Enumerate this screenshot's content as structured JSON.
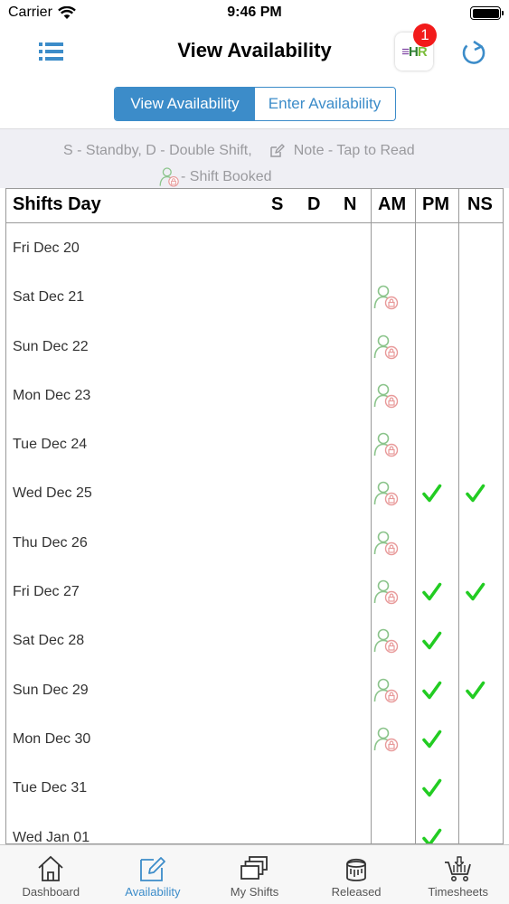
{
  "status_bar": {
    "carrier": "Carrier",
    "time": "9:46 PM"
  },
  "nav": {
    "title": "View Availability",
    "notification_count": "1",
    "logo_text": {
      "e": "≡",
      "h": "H",
      "r": "R"
    },
    "icons": {
      "menu": "list-icon",
      "refresh": "refresh-icon"
    }
  },
  "segments": {
    "view": "View Availability",
    "enter": "Enter Availability",
    "selected": "view"
  },
  "legend": {
    "line1": "S - Standby, D - Double Shift,",
    "note": "Note - Tap to Read",
    "booked": "- Shift Booked"
  },
  "table": {
    "headers": {
      "day": "Shifts Day",
      "s": "S",
      "d": "D",
      "n": "N",
      "am": "AM",
      "pm": "PM",
      "ns": "NS"
    },
    "rows": [
      {
        "day": "Fri Dec 20",
        "am": "",
        "pm": "",
        "ns": ""
      },
      {
        "day": "Sat Dec 21",
        "am": "booked",
        "pm": "",
        "ns": ""
      },
      {
        "day": "Sun Dec 22",
        "am": "booked",
        "pm": "",
        "ns": ""
      },
      {
        "day": "Mon Dec 23",
        "am": "booked",
        "pm": "",
        "ns": ""
      },
      {
        "day": "Tue Dec 24",
        "am": "booked",
        "pm": "",
        "ns": ""
      },
      {
        "day": "Wed Dec 25",
        "am": "booked",
        "pm": "check",
        "ns": "check"
      },
      {
        "day": "Thu Dec 26",
        "am": "booked",
        "pm": "",
        "ns": ""
      },
      {
        "day": "Fri Dec 27",
        "am": "booked",
        "pm": "check",
        "ns": "check"
      },
      {
        "day": "Sat Dec 28",
        "am": "booked",
        "pm": "check",
        "ns": ""
      },
      {
        "day": "Sun Dec 29",
        "am": "booked",
        "pm": "check",
        "ns": "check"
      },
      {
        "day": "Mon Dec 30",
        "am": "booked",
        "pm": "check",
        "ns": ""
      },
      {
        "day": "Tue Dec 31",
        "am": "",
        "pm": "check",
        "ns": ""
      },
      {
        "day": "Wed Jan 01",
        "am": "",
        "pm": "check",
        "ns": ""
      }
    ]
  },
  "tabs": [
    {
      "label": "Dashboard",
      "icon": "home-icon",
      "active": false
    },
    {
      "label": "Availability",
      "icon": "edit-icon",
      "active": true
    },
    {
      "label": "My Shifts",
      "icon": "stacked-windows-icon",
      "active": false
    },
    {
      "label": "Released",
      "icon": "paint-bucket-icon",
      "active": false
    },
    {
      "label": "Timesheets",
      "icon": "cart-icon",
      "active": false
    }
  ],
  "colors": {
    "accent": "#3c8cc9",
    "check": "#22cc22",
    "booked_person": "#8bc48b",
    "booked_lock": "#e89a9a",
    "badge": "#f21b1b"
  }
}
